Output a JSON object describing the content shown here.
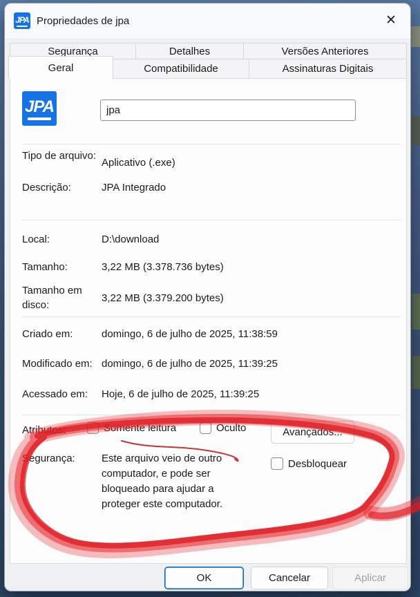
{
  "window": {
    "title": "Propriedades de jpa",
    "close_glyph": "✕"
  },
  "app_icon": {
    "text": "JPA"
  },
  "tabs": {
    "row1": [
      "Segurança",
      "Detalhes",
      "Versões Anteriores"
    ],
    "active": "Geral",
    "row2": [
      "Compatibilidade",
      "Assinaturas Digitais"
    ]
  },
  "file": {
    "name": "jpa"
  },
  "rows": {
    "tipo": {
      "label": "Tipo de arquivo:",
      "value": "Aplicativo (.exe)"
    },
    "descricao": {
      "label": "Descrição:",
      "value": "JPA Integrado"
    },
    "local": {
      "label": "Local:",
      "value": "D:\\download"
    },
    "tamanho": {
      "label": "Tamanho:",
      "value": "3,22 MB (3.378.736 bytes)"
    },
    "tamanho_disco": {
      "label": "Tamanho em disco:",
      "value": "3,22 MB (3.379.200 bytes)"
    },
    "criado": {
      "label": "Criado em:",
      "value": "domingo, 6 de julho de 2025, 11:38:59"
    },
    "modificado": {
      "label": "Modificado em:",
      "value": "domingo, 6 de julho de 2025, 11:39:25"
    },
    "acessado": {
      "label": "Acessado em:",
      "value": "Hoje, 6 de julho de 2025, 11:39:25"
    }
  },
  "attributes": {
    "label": "Atributos:",
    "checkbox_readonly": "Somente leitura",
    "checkbox_hidden": "Oculto",
    "advanced_button": "Avançados..."
  },
  "security": {
    "label": "Segurança:",
    "message": "Este arquivo veio de outro computador, e pode ser bloqueado para ajudar a proteger este computador.",
    "unblock_label": "Desbloquear"
  },
  "footer": {
    "ok": "OK",
    "cancel": "Cancelar",
    "apply": "Aplicar"
  },
  "colors": {
    "accent_blue": "#0067c0",
    "icon_blue": "#1573e6",
    "marker_red": "#e2252b"
  }
}
